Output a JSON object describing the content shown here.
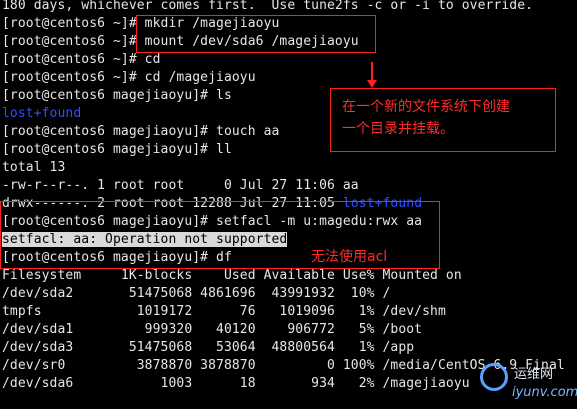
{
  "terminal": {
    "lines": [
      {
        "segments": [
          {
            "text": "180 days, whichever comes first.  Use tune2fs -c or -i to override."
          }
        ]
      },
      {
        "segments": [
          {
            "text": "[root@centos6 ~]# mkdir /magejiaoyu"
          }
        ]
      },
      {
        "segments": [
          {
            "text": "[root@centos6 ~]# mount /dev/sda6 /magejiaoyu"
          }
        ]
      },
      {
        "segments": [
          {
            "text": "[root@centos6 ~]# cd"
          }
        ]
      },
      {
        "segments": [
          {
            "text": "[root@centos6 ~]# cd /magejiaoyu"
          }
        ]
      },
      {
        "segments": [
          {
            "text": "[root@centos6 magejiaoyu]# ls"
          }
        ]
      },
      {
        "segments": [
          {
            "text": "lost+found",
            "color": "blue"
          }
        ]
      },
      {
        "segments": [
          {
            "text": "[root@centos6 magejiaoyu]# touch aa"
          }
        ]
      },
      {
        "segments": [
          {
            "text": "[root@centos6 magejiaoyu]# ll"
          }
        ]
      },
      {
        "segments": [
          {
            "text": "total 13"
          }
        ]
      },
      {
        "segments": [
          {
            "text": "-rw-r--r--. 1 root root     0 Jul 27 11:06 aa"
          }
        ]
      },
      {
        "segments": [
          {
            "text": "drwx------. 2 root root 12288 Jul 27 11:05 "
          },
          {
            "text": "lost+found",
            "color": "blue"
          }
        ]
      },
      {
        "segments": [
          {
            "text": "[root@centos6 magejiaoyu]# setfacl -m u:magedu:rwx aa"
          }
        ]
      },
      {
        "segments": [
          {
            "text": "setfacl: aa: Operation not supported",
            "highlight": true
          }
        ]
      },
      {
        "segments": [
          {
            "text": "[root@centos6 magejiaoyu]# df"
          }
        ]
      },
      {
        "segments": [
          {
            "text": "Filesystem     1K-blocks    Used Available Use% Mounted on"
          }
        ]
      },
      {
        "segments": [
          {
            "text": "/dev/sda2       51475068 4861696  43991932  10% /"
          }
        ]
      },
      {
        "segments": [
          {
            "text": "tmpfs            1019172      76   1019096   1% /dev/shm"
          }
        ]
      },
      {
        "segments": [
          {
            "text": "/dev/sda1         999320   40120    906772   5% /boot"
          }
        ]
      },
      {
        "segments": [
          {
            "text": "/dev/sda3       51475068   53064  48800564   1% /app"
          }
        ]
      },
      {
        "segments": [
          {
            "text": "/dev/sr0         3878870 3878870         0 100% /media/CentOS 6.9 Final"
          }
        ]
      },
      {
        "segments": [
          {
            "text": "/dev/sda6           1003      18       934   2% /magejiaoyu"
          }
        ]
      }
    ]
  },
  "annotations": {
    "note1_line1": "在一个新的文件系统下创建",
    "note1_line2": "一个目录并挂载。",
    "note2": "无法使用acl"
  },
  "watermark": {
    "text": "运维网",
    "sub": "iyunv.com"
  },
  "colors": {
    "background": "#000000",
    "text": "#e6e6e6",
    "directory": "#2f4fff",
    "annotation": "#ff2020"
  }
}
